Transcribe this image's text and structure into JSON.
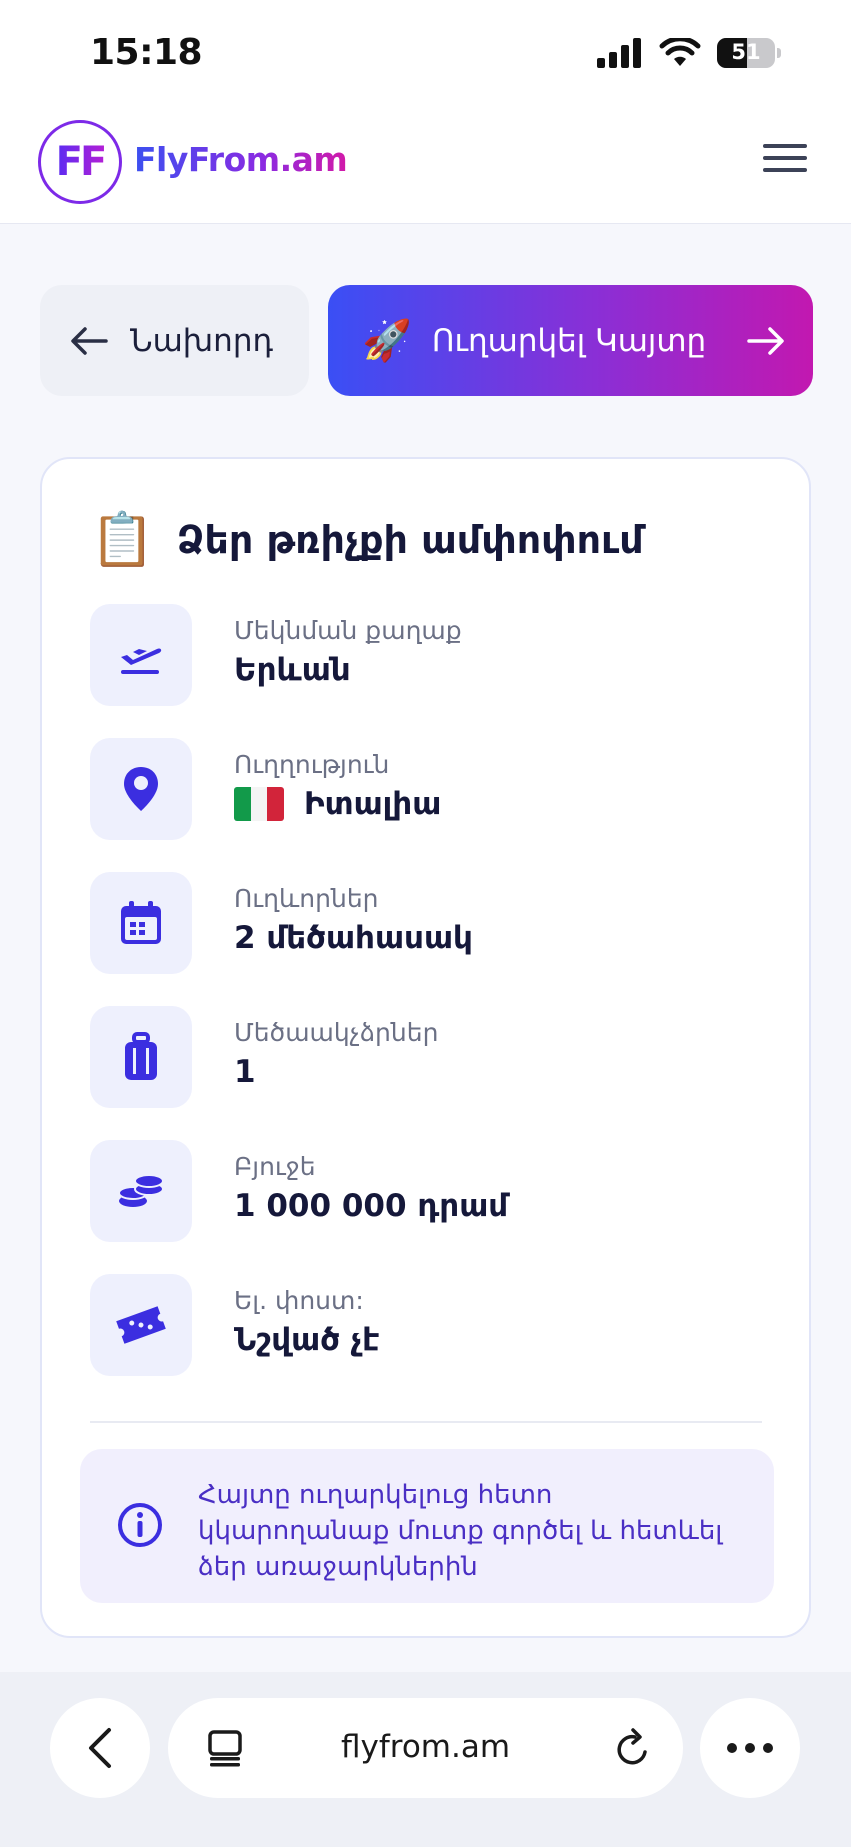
{
  "status": {
    "time": "15:18",
    "battery": "51",
    "battery_level": 0.51
  },
  "header": {
    "logo_mark": "FF",
    "logo_text": "FlyFrom.am",
    "menu_icon": "hamburger-menu-icon"
  },
  "nav": {
    "prev_label": "Նախորդ",
    "submit_label": "Ուղարկել Կայտը",
    "submit_icon": "🚀"
  },
  "summary": {
    "icon": "📋",
    "title": "Ձեր թռիչքի ամփոփում",
    "rows": [
      {
        "icon": "plane-departure-icon",
        "label": "Մեկնման քաղաք",
        "value": "Երևան"
      },
      {
        "icon": "location-pin-icon",
        "label": "Ուղղություն",
        "value": "Իտալիա"
      },
      {
        "icon": "calendar-icon",
        "label": "Ուղևորներ",
        "value": "2 մեծահասակ"
      },
      {
        "icon": "luggage-icon",
        "label": "Մեծաակչձրներ",
        "value": "1"
      },
      {
        "icon": "coins-icon",
        "label": "Բյուջե",
        "value": "1 000 000 դրամ"
      },
      {
        "icon": "ticket-icon",
        "label": "Ել. փոստ:",
        "value": "Նշված չէ"
      }
    ],
    "info_text": "Հայտը ուղարկելուց հետո կկարողանաք մուտք գործել և հետևել ձեր առաջարկներին"
  },
  "browser": {
    "url": "flyfrom.am"
  },
  "colors": {
    "accent": "#3b2ee0",
    "gradient_start": "#3a4ff5",
    "gradient_end": "#c218b0",
    "icon_bg": "#eef0fd"
  }
}
